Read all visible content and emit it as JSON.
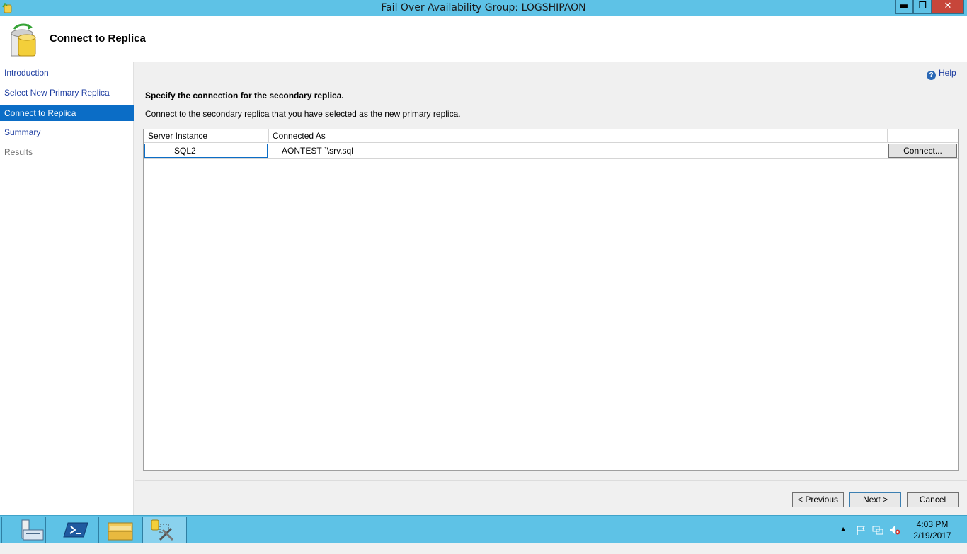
{
  "window": {
    "title": "Fail Over Availability Group: LOGSHIPAON",
    "minimize_label": "▬",
    "maximize_label": "❐",
    "close_label": "✕"
  },
  "header": {
    "title": "Connect to Replica",
    "icon": "database-refresh-icon"
  },
  "nav": {
    "items": [
      {
        "label": "Introduction",
        "state": "normal"
      },
      {
        "label": "Select New Primary Replica",
        "state": "normal"
      },
      {
        "label": "Connect to Replica",
        "state": "active"
      },
      {
        "label": "Summary",
        "state": "normal"
      },
      {
        "label": "Results",
        "state": "disabled"
      }
    ]
  },
  "main": {
    "help_label": "Help",
    "heading": "Specify the connection for the secondary replica.",
    "description": "Connect to the secondary replica that you have selected as the new primary replica.",
    "grid": {
      "columns": [
        "Server Instance",
        "Connected As",
        ""
      ],
      "rows": [
        {
          "server": "SQL2",
          "connected_as": "AONTEST  `\\srv.sql",
          "action_label": "Connect..."
        }
      ]
    }
  },
  "footer": {
    "previous_label": "< Previous",
    "next_label": "Next >",
    "cancel_label": "Cancel"
  },
  "taskbar": {
    "apps": [
      "server-manager-icon",
      "powershell-icon",
      "file-explorer-icon",
      "sql-wizard-icon"
    ],
    "clock_time": "4:03 PM",
    "clock_date": "2/19/2017",
    "tray_up_label": "▲"
  },
  "colors": {
    "accent": "#0b6dc6",
    "titlebar": "#5ec2e6",
    "link": "#1c3ca0"
  }
}
